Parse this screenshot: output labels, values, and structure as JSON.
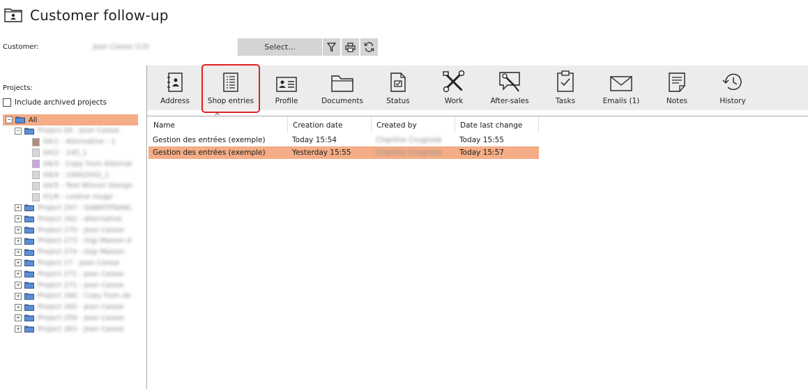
{
  "header": {
    "title": "Customer follow-up",
    "icon": "folder-contact-icon"
  },
  "customer": {
    "label": "Customer:",
    "value": "Jean Caisse (13)",
    "select_label": "Select...",
    "tools": [
      "filter-icon",
      "print-icon",
      "refresh-icon"
    ]
  },
  "projects": {
    "label": "Projects:",
    "include_archived_label": "Include archived projects",
    "include_archived_checked": false,
    "tree": [
      {
        "label": "All",
        "level": 0,
        "expander": "−",
        "kind": "folder",
        "selected": true
      },
      {
        "label": "Project 04 - Jean Caisse",
        "level": 1,
        "expander": "−",
        "kind": "folder"
      },
      {
        "label": "04/1 - Alternative - 1",
        "level": 2,
        "kind": "doc",
        "color": "#b08e7a"
      },
      {
        "label": "04/2 - 145_1",
        "level": 2,
        "kind": "doc",
        "color": "#d7d7d7"
      },
      {
        "label": "04/3 - Copy from Alternat",
        "level": 2,
        "kind": "doc",
        "color": "#c9a6e0"
      },
      {
        "label": "04/4 - 10002932_1",
        "level": 2,
        "kind": "doc",
        "color": "#d7d7d7"
      },
      {
        "label": "04/5 - Test Winner Design",
        "level": 2,
        "kind": "doc",
        "color": "#d7d7d7"
      },
      {
        "label": "01/6 - cuisine rouge",
        "level": 2,
        "kind": "doc",
        "color": "#d7d7d7"
      },
      {
        "label": "Project 297 - SABATIFRANC",
        "level": 1,
        "expander": "+",
        "kind": "folder"
      },
      {
        "label": "Project 262 - Alternative",
        "level": 1,
        "expander": "+",
        "kind": "folder"
      },
      {
        "label": "Project 270 - Jean Caisse",
        "level": 1,
        "expander": "+",
        "kind": "folder"
      },
      {
        "label": "Project 273 - Gigi Maison d",
        "level": 1,
        "expander": "+",
        "kind": "folder"
      },
      {
        "label": "Project 274 - Gigi Maison",
        "level": 1,
        "expander": "+",
        "kind": "folder"
      },
      {
        "label": "Project 27 - Jean Caisse",
        "level": 1,
        "expander": "+",
        "kind": "folder"
      },
      {
        "label": "Project 271 - Jean Caisse",
        "level": 1,
        "expander": "+",
        "kind": "folder"
      },
      {
        "label": "Project 271 - Jean Caisse",
        "level": 1,
        "expander": "+",
        "kind": "folder"
      },
      {
        "label": "Project 260 - Copy from de",
        "level": 1,
        "expander": "+",
        "kind": "folder"
      },
      {
        "label": "Project 265 - Jean Caisse",
        "level": 1,
        "expander": "+",
        "kind": "folder"
      },
      {
        "label": "Project 259 - Jean Caisse",
        "level": 1,
        "expander": "+",
        "kind": "folder"
      },
      {
        "label": "Project 263 - Jean Caisse",
        "level": 1,
        "expander": "+",
        "kind": "folder"
      }
    ]
  },
  "toolbar": {
    "items": [
      {
        "label": "Address",
        "icon": "address-book-icon"
      },
      {
        "label": "Shop entries",
        "icon": "shop-entries-icon",
        "active": true
      },
      {
        "label": "Profile",
        "icon": "profile-card-icon"
      },
      {
        "label": "Documents",
        "icon": "documents-folder-icon"
      },
      {
        "label": "Status",
        "icon": "status-icon"
      },
      {
        "label": "Work",
        "icon": "work-tools-icon"
      },
      {
        "label": "After-sales",
        "icon": "after-sales-icon"
      },
      {
        "label": "Tasks",
        "icon": "tasks-clipboard-icon"
      },
      {
        "label": "Emails (1)",
        "icon": "email-icon"
      },
      {
        "label": "Notes",
        "icon": "notes-icon"
      },
      {
        "label": "History",
        "icon": "history-icon"
      }
    ]
  },
  "grid": {
    "sort_indicator": "^",
    "columns": [
      "Name",
      "Creation date",
      "Created by",
      "Date last change"
    ],
    "rows": [
      {
        "cells": [
          "Gestion des entrées (exemple)",
          "Today 15:54",
          "Charline Crugnola",
          "Today 15:55"
        ],
        "selected": false
      },
      {
        "cells": [
          "Gestion des entrées (exemple)",
          "Yesterday 15:55",
          "Charline Crugnola",
          "Today 15:57"
        ],
        "selected": true
      }
    ]
  },
  "colors": {
    "selection": "#f4ad86",
    "toolbar_bg": "#ececec",
    "highlight": "#e02020"
  }
}
